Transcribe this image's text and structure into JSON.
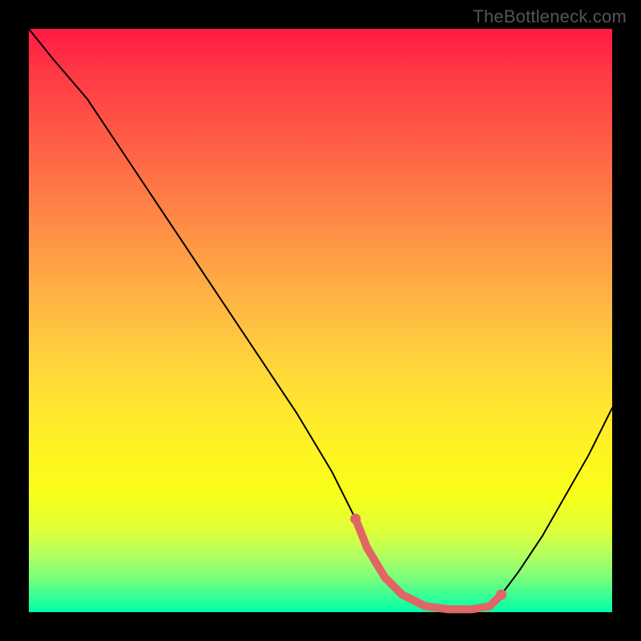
{
  "watermark": "TheBottleneck.com",
  "chart_data": {
    "type": "line",
    "title": "",
    "xlabel": "",
    "ylabel": "",
    "xlim": [
      0,
      100
    ],
    "ylim": [
      0,
      100
    ],
    "series": [
      {
        "name": "bottleneck-curve",
        "x": [
          0,
          4,
          10,
          16,
          22,
          28,
          34,
          40,
          46,
          52,
          56,
          58,
          61,
          64,
          68,
          72,
          76,
          79,
          81,
          84,
          88,
          92,
          96,
          100
        ],
        "values": [
          100,
          95,
          88,
          79,
          70,
          61,
          52,
          43,
          34,
          24,
          16,
          11,
          6,
          3,
          1,
          0.5,
          0.5,
          1,
          3,
          7,
          13,
          20,
          27,
          35
        ]
      },
      {
        "name": "highlighted-optimal-range",
        "x": [
          56,
          58,
          61,
          64,
          68,
          72,
          76,
          79,
          81
        ],
        "values": [
          16,
          11,
          6,
          3,
          1,
          0.5,
          0.5,
          1,
          3
        ]
      }
    ],
    "gradient_stops": [
      {
        "pos": 0,
        "color": "#ff1a44"
      },
      {
        "pos": 18,
        "color": "#ff5946"
      },
      {
        "pos": 38,
        "color": "#ff9a45"
      },
      {
        "pos": 58,
        "color": "#ffd63a"
      },
      {
        "pos": 74,
        "color": "#fff61f"
      },
      {
        "pos": 90,
        "color": "#b5ff5d"
      },
      {
        "pos": 100,
        "color": "#00ffa7"
      }
    ]
  }
}
